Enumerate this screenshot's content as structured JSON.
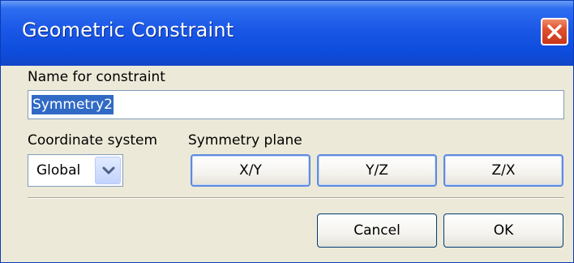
{
  "window": {
    "title": "Geometric Constraint"
  },
  "name": {
    "label": "Name for constraint",
    "value": "Symmetry2"
  },
  "coordinate_system": {
    "label": "Coordinate system",
    "selected": "Global"
  },
  "symmetry_plane": {
    "label": "Symmetry plane",
    "buttons": [
      "X/Y",
      "Y/Z",
      "Z/X"
    ]
  },
  "footer": {
    "cancel_label": "Cancel",
    "ok_label": "OK"
  },
  "colors": {
    "titlebar": "#1a57e6",
    "close": "#e0502e",
    "dialog_bg": "#ece9d8",
    "selection": "#316ac5"
  },
  "icons": {
    "close": "close-icon",
    "dropdown": "chevron-down-icon"
  }
}
